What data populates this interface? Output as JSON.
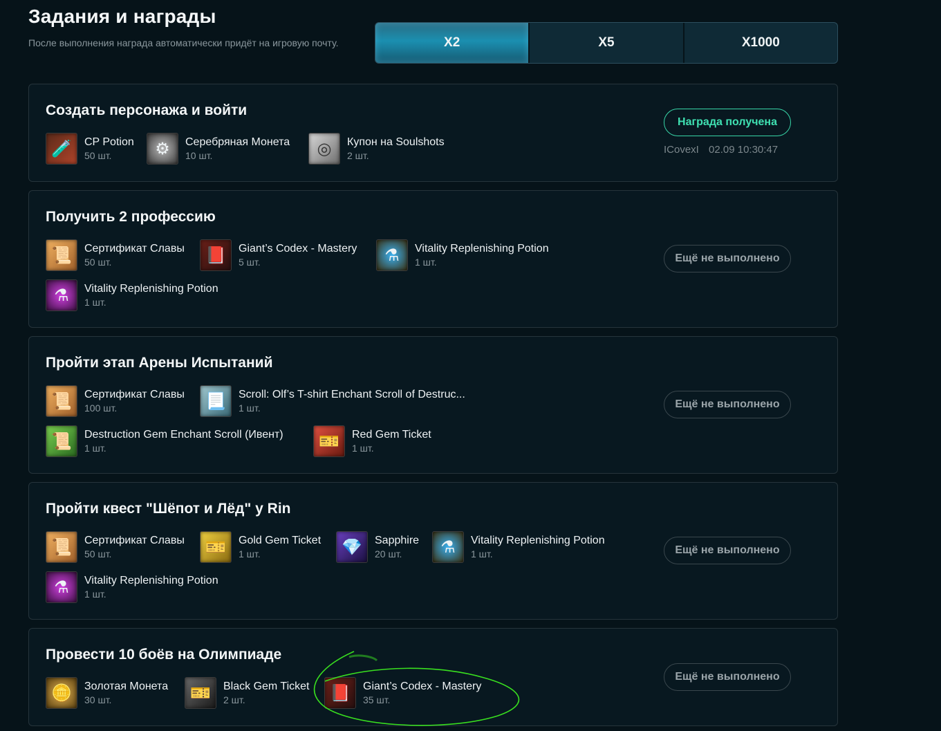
{
  "header": {
    "title": "Задания и награды",
    "subtitle": "После выполнения награда автоматически придёт на игровую почту."
  },
  "server_tabs": [
    {
      "label": "X2",
      "active": true
    },
    {
      "label": "X5",
      "active": false
    },
    {
      "label": "X1000",
      "active": false
    }
  ],
  "quests": [
    {
      "title": "Создать персонажа и войти",
      "rewards": [
        {
          "name": "CP Potion",
          "qty": "50 шт.",
          "icon": "cp-potion-icon"
        },
        {
          "name": "Серебряная Монета",
          "qty": "10 шт.",
          "icon": "silver-coin-icon"
        },
        {
          "name": "Купон на Soulshots",
          "qty": "2 шт.",
          "icon": "soulshot-coupon-icon"
        }
      ],
      "status": "Награда получена",
      "claimed_by": "ICovexI",
      "claimed_at": "02.09 10:30:47"
    },
    {
      "title": "Получить 2 профессию",
      "rewards": [
        {
          "name": "Сертификат Славы",
          "qty": "50 шт.",
          "icon": "glory-certificate-icon"
        },
        {
          "name": "Giant’s Codex - Mastery",
          "qty": "5 шт.",
          "icon": "giants-codex-icon"
        },
        {
          "name": "Vitality Replenishing Potion",
          "qty": "1 шт.",
          "icon": "vitality-potion-blue-icon"
        },
        {
          "name": "Vitality Replenishing Potion",
          "qty": "1 шт.",
          "icon": "vitality-potion-purple-icon"
        }
      ],
      "status": "Ещё не выполнено"
    },
    {
      "title": "Пройти этап Арены Испытаний",
      "rewards": [
        {
          "name": "Сертификат Славы",
          "qty": "100 шт.",
          "icon": "glory-certificate-icon"
        },
        {
          "name": "Scroll: Olf’s T-shirt Enchant Scroll of Destruc...",
          "qty": "1 шт.",
          "icon": "enchant-scroll-icon"
        },
        {
          "name": "Destruction Gem Enchant Scroll (Ивент)",
          "qty": "1 шт.",
          "icon": "gem-enchant-scroll-icon"
        },
        {
          "name": "Red Gem Ticket",
          "qty": "1 шт.",
          "icon": "red-ticket-icon"
        }
      ],
      "status": "Ещё не выполнено"
    },
    {
      "title": "Пройти квест \"Шёпот и Лёд\" у Rin",
      "rewards": [
        {
          "name": "Сертификат Славы",
          "qty": "50 шт.",
          "icon": "glory-certificate-icon"
        },
        {
          "name": "Gold Gem Ticket",
          "qty": "1 шт.",
          "icon": "gold-ticket-icon"
        },
        {
          "name": "Sapphire",
          "qty": "20 шт.",
          "icon": "sapphire-icon"
        },
        {
          "name": "Vitality Replenishing Potion",
          "qty": "1 шт.",
          "icon": "vitality-potion-blue-icon"
        },
        {
          "name": "Vitality Replenishing Potion",
          "qty": "1 шт.",
          "icon": "vitality-potion-purple-icon"
        }
      ],
      "status": "Ещё не выполнено"
    },
    {
      "title": "Провести 10 боёв на Олимпиаде",
      "rewards": [
        {
          "name": "Золотая Монета",
          "qty": "30 шт.",
          "icon": "gold-coin-icon"
        },
        {
          "name": "Black Gem Ticket",
          "qty": "2 шт.",
          "icon": "black-ticket-icon"
        },
        {
          "name": "Giant’s Codex - Mastery",
          "qty": "35 шт.",
          "icon": "giants-codex-icon"
        }
      ],
      "status": "Ещё не выполнено"
    }
  ],
  "colors": {
    "background": "#061319",
    "accent_done": "#3fe0b1",
    "annotation": "#39e01f"
  }
}
